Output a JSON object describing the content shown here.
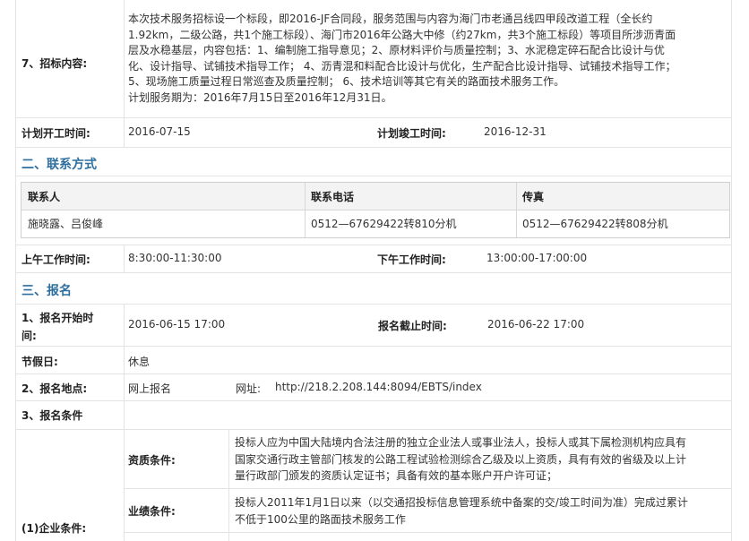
{
  "tender_content": {
    "label": "7、招标内容:",
    "lines": [
      "本次技术服务招标设一个标段，即2016-JF合同段，服务范围与内容为海门市老通吕线四甲段改道工程（全长约",
      "1.92km，二级公路，共1个施工标段）、海门市2016年公路大中修（约27km，共3个施工标段）等项目所涉沥青面",
      "层及水稳基层，内容包括：1、编制施工指导意见；2、原材料评价与质量控制；3、水泥稳定碎石配合比设计与优",
      "化、设计指导、试铺技术指导工作；  4、沥青混和料配合比设计与优化，生产配合比设计指导、试铺技术指导工作；",
      "5、现场施工质量过程日常巡查及质量控制；  6、技术培训等其它有关的路面技术服务工作。",
      "计划服务期为：2016年7月15日至2016年12月31日。"
    ]
  },
  "schedule": {
    "start_label": "计划开工时间:",
    "start_value": "2016-07-15",
    "end_label": "计划竣工时间:",
    "end_value": "2016-12-31"
  },
  "contact_section": {
    "title": "二、联系方式",
    "headers": [
      "联系人",
      "联系电话",
      "传真"
    ],
    "row": [
      "施晓露、吕俊峰",
      "0512—67629422转810分机",
      "0512—67629422转808分机"
    ]
  },
  "work_hours": {
    "am_label": "上午工作时间:",
    "am_value": "8:30:00-11:30:00",
    "pm_label": "下午工作时间:",
    "pm_value": "13:00:00-17:00:00"
  },
  "signup_section": {
    "title": "三、报名",
    "start_label_1": "1、报名开始时",
    "start_label_2": "间:",
    "start_value": "2016-06-15 17:00",
    "end_label": "报名截止时间:",
    "end_value": "2016-06-22 17:00",
    "holiday_label": "节假日:",
    "holiday_value": "休息",
    "place_label": "2、报名地点:",
    "place_value": "网上报名",
    "url_label": "网址:",
    "url_value": "http://218.2.208.144:8094/EBTS/index",
    "conditions_label": "3、报名条件"
  },
  "conditions": {
    "enterprise_label": "(1)企业条件:",
    "qualification_label": "资质条件:",
    "qualification_lines": [
      "投标人应为中国大陆境内合法注册的独立企业法人或事业法人，投标人或其下属检测机构应具有",
      "国家交通行政主管部门核发的公路工程试验检测综合乙级及以上资质，具有有效的省级及以上计",
      "量行政部门颁发的资质认定证书；具备有效的基本账户开户许可证；"
    ],
    "performance_label": "业绩条件:",
    "performance_lines": [
      "投标人2011年1月1日以来（以交通招投标信息管理系统中备案的交/竣工时间为准）完成过累计",
      "不低于100公里的路面技术服务工作"
    ]
  }
}
